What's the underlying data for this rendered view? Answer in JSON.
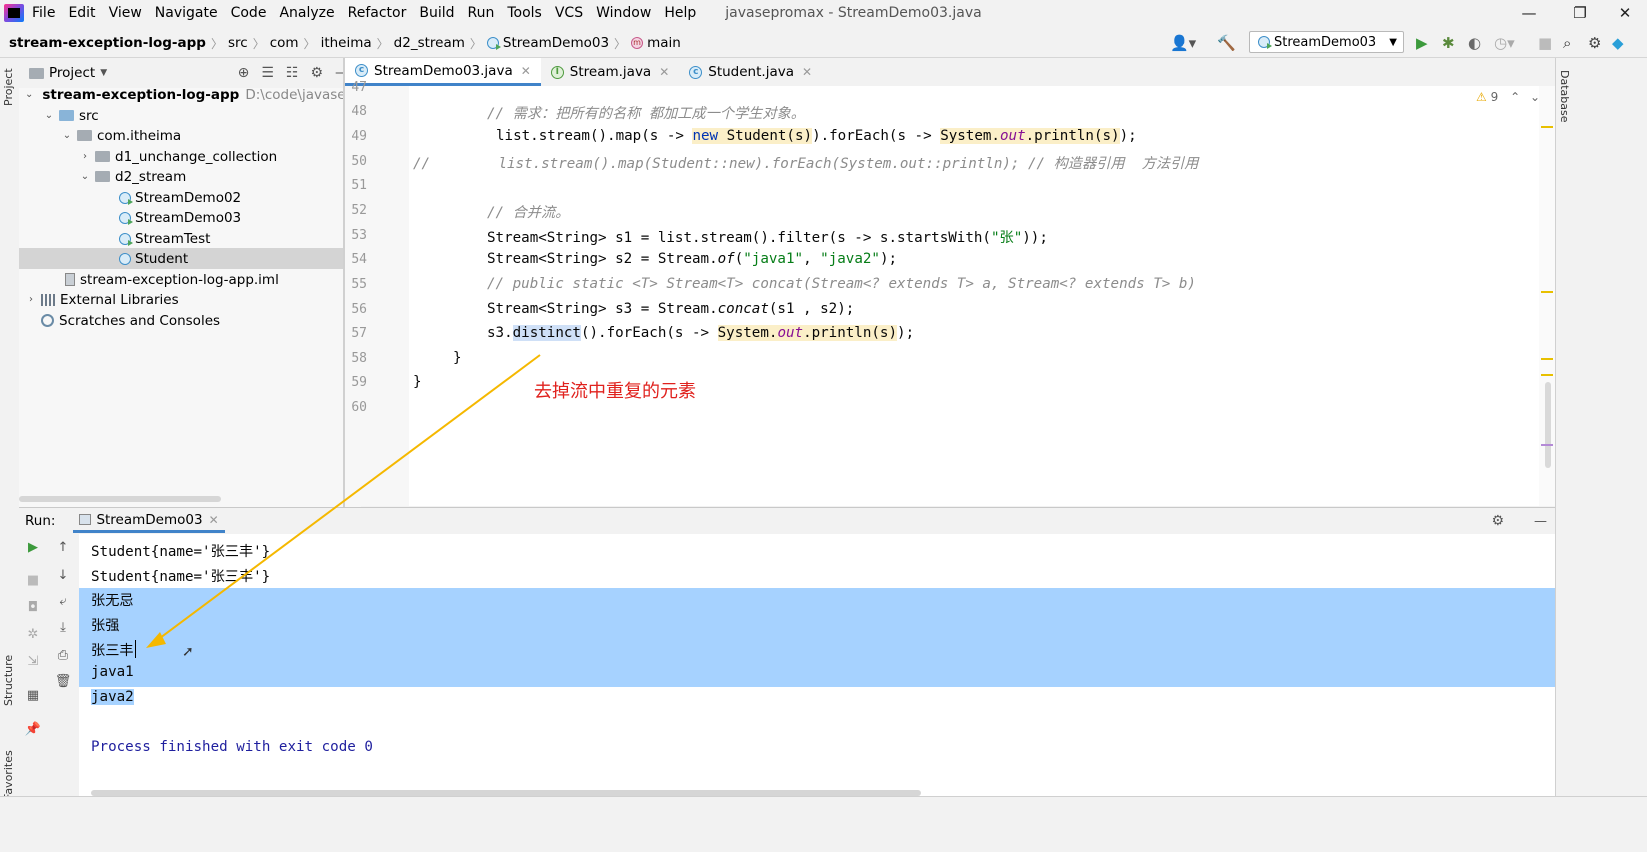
{
  "menu": [
    "File",
    "Edit",
    "View",
    "Navigate",
    "Code",
    "Analyze",
    "Refactor",
    "Build",
    "Run",
    "Tools",
    "VCS",
    "Window",
    "Help"
  ],
  "window_title": "javasepromax - StreamDemo03.java",
  "breadcrumb": [
    "stream-exception-log-app",
    "src",
    "com",
    "itheima",
    "d2_stream",
    "StreamDemo03",
    "main"
  ],
  "run_config": "StreamDemo03",
  "project_panel": {
    "title": "Project",
    "root_name": "stream-exception-log-app",
    "root_path": "D:\\code\\javasepro",
    "items": [
      {
        "label": "src"
      },
      {
        "label": "com.itheima"
      },
      {
        "label": "d1_unchange_collection"
      },
      {
        "label": "d2_stream"
      },
      {
        "label": "StreamDemo02"
      },
      {
        "label": "StreamDemo03"
      },
      {
        "label": "StreamTest"
      },
      {
        "label": "Student"
      },
      {
        "label": "stream-exception-log-app.iml"
      },
      {
        "label": "External Libraries"
      },
      {
        "label": "Scratches and Consoles"
      }
    ]
  },
  "editor_tabs": [
    {
      "label": "StreamDemo03.java",
      "active": true
    },
    {
      "label": "Stream.java",
      "active": false
    },
    {
      "label": "Student.java",
      "active": false
    }
  ],
  "warnings": "9",
  "code_lines": [
    {
      "num": "47",
      "text": ""
    },
    {
      "num": "48",
      "text": "// 需求：把所有的名称 都加工成一个学生对象。"
    },
    {
      "num": "49",
      "text": "list.stream().map(s -> new Student(s)).forEach(s -> System.out.println(s));"
    },
    {
      "num": "50",
      "text": "//        list.stream().map(Student::new).forEach(System.out::println); // 构造器引用  方法引用"
    },
    {
      "num": "51",
      "text": ""
    },
    {
      "num": "52",
      "text": "// 合并流。"
    },
    {
      "num": "53",
      "text": "Stream<String> s1 = list.stream().filter(s -> s.startsWith(\"张\"));"
    },
    {
      "num": "54",
      "text": "Stream<String> s2 = Stream.of(\"java1\", \"java2\");"
    },
    {
      "num": "55",
      "text": "// public static <T> Stream<T> concat(Stream<? extends T> a, Stream<? extends T> b)"
    },
    {
      "num": "56",
      "text": "Stream<String> s3 = Stream.concat(s1 , s2);"
    },
    {
      "num": "57",
      "text": "s3.distinct().forEach(s -> System.out.println(s));"
    },
    {
      "num": "58",
      "text": "}"
    },
    {
      "num": "59",
      "text": "}"
    },
    {
      "num": "60",
      "text": ""
    }
  ],
  "annotation": "去掉流中重复的元素",
  "run_panel": {
    "label": "Run:",
    "tab": "StreamDemo03",
    "output": [
      "Student{name='张三丰'}",
      "Student{name='张三丰'}",
      "张无忌",
      "张强",
      "张三丰",
      "java1",
      "java2",
      "",
      "Process finished with exit code 0"
    ]
  },
  "side_labels": {
    "left_top": "Project",
    "left_mid": "Structure",
    "left_bottom": "Favorites",
    "right": "Database"
  },
  "colors": {
    "accent": "#4083c9",
    "selection": "#a6d2ff",
    "annotation": "#e0221e",
    "arrow": "#f5b800"
  }
}
